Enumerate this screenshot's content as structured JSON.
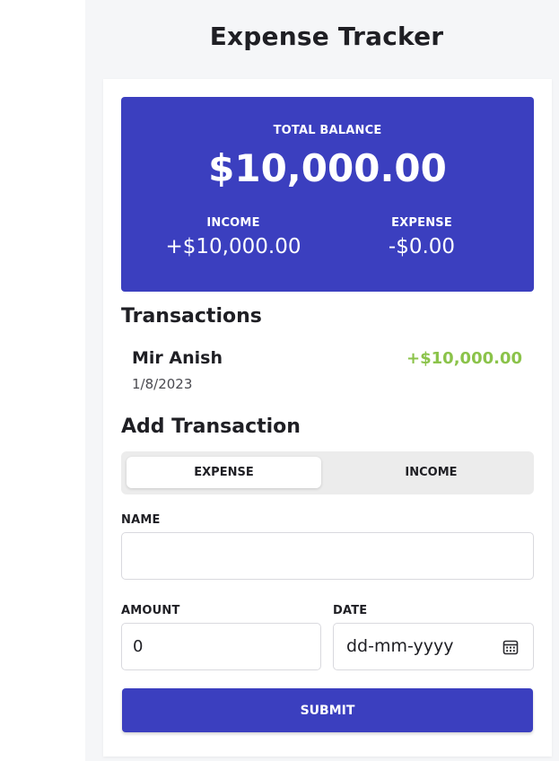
{
  "app": {
    "title": "Expense Tracker"
  },
  "balance": {
    "label": "TOTAL BALANCE",
    "value": "$10,000.00",
    "income_label": "INCOME",
    "income_value": "+$10,000.00",
    "expense_label": "EXPENSE",
    "expense_value": "-$0.00"
  },
  "transactions": {
    "title": "Transactions",
    "items": [
      {
        "name": "Mir Anish",
        "date": "1/8/2023",
        "amount": "+$10,000.00"
      }
    ]
  },
  "add_transaction": {
    "title": "Add Transaction",
    "toggle": {
      "expense_label": "EXPENSE",
      "income_label": "INCOME",
      "selected": "EXPENSE"
    },
    "name": {
      "label": "NAME",
      "value": ""
    },
    "amount": {
      "label": "AMOUNT",
      "value": "0"
    },
    "date": {
      "label": "DATE",
      "placeholder": "dd-mm-yyyy"
    },
    "submit_label": "SUBMIT"
  },
  "colors": {
    "brand": "#3b3fbf",
    "income_amount": "#8bc34a",
    "panel_background": "#f5f6f8",
    "toggle_background": "#ececec"
  },
  "icons": {
    "date_picker": "calendar-icon"
  }
}
